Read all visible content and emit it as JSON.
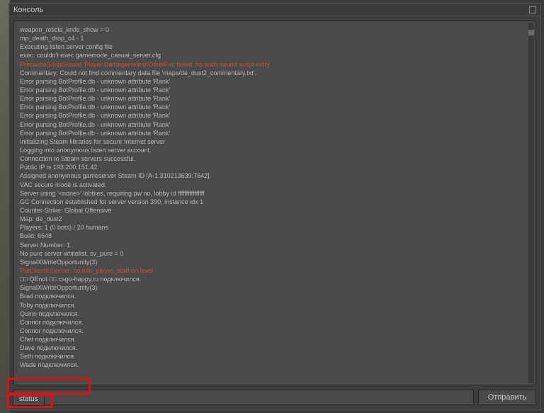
{
  "title": "Консоль",
  "send_label": "Отправить",
  "input_value": "status",
  "autocomplete_value": "status",
  "log_lines": [
    {
      "text": "weapon_reticle_knife_show = 0",
      "cls": ""
    },
    {
      "text": "mp_death_drop_c4 - 1",
      "cls": ""
    },
    {
      "text": "Executing listen server config file",
      "cls": ""
    },
    {
      "text": "exec: couldn't exec gamemode_casual_server.cfg",
      "cls": ""
    },
    {
      "text": "PrecacheScriptSound 'Player.DamageHelmetOtherFar' failed, no such sound script entry",
      "cls": "red"
    },
    {
      "text": "Commentary: Could not find commentary data file 'maps/de_dust2_commentary.txt'.",
      "cls": ""
    },
    {
      "text": "Error parsing BotProfile.db - unknown attribute 'Rank'",
      "cls": ""
    },
    {
      "text": "Error parsing BotProfile.db - unknown attribute 'Rank'",
      "cls": ""
    },
    {
      "text": "Error parsing BotProfile.db - unknown attribute 'Rank'",
      "cls": ""
    },
    {
      "text": "Error parsing BotProfile.db - unknown attribute 'Rank'",
      "cls": ""
    },
    {
      "text": "Error parsing BotProfile.db - unknown attribute 'Rank'",
      "cls": ""
    },
    {
      "text": "Error parsing BotProfile.db - unknown attribute 'Rank'",
      "cls": ""
    },
    {
      "text": "Error parsing BotProfile.db - unknown attribute 'Rank'",
      "cls": ""
    },
    {
      "text": "Initializing Steam libraries for secure Internet server",
      "cls": ""
    },
    {
      "text": "Logging into anonymous listen server account.",
      "cls": ""
    },
    {
      "text": "Connection to Steam servers successful.",
      "cls": ""
    },
    {
      "text": "   Public IP is 193.200.151.42.",
      "cls": ""
    },
    {
      "text": "Assigned anonymous gameserver Steam ID [A-1:310213639:7642].",
      "cls": ""
    },
    {
      "text": "VAC secure mode is activated.",
      "cls": ""
    },
    {
      "text": "Server using '<none>' lobbies, requiring pw no, lobby id ffffffffffffffff",
      "cls": ""
    },
    {
      "text": "GC Connection established for server version 390, instance idx 1",
      "cls": ""
    },
    {
      "text": " ",
      "cls": ""
    },
    {
      "text": "Counter-Strike: Global Offensive",
      "cls": ""
    },
    {
      "text": "Map: de_dust2",
      "cls": ""
    },
    {
      "text": "Players: 1 (0 bots) / 20 humans",
      "cls": ""
    },
    {
      "text": "Build: 6548",
      "cls": ""
    },
    {
      "text": "Server Number: 1",
      "cls": ""
    },
    {
      "text": " ",
      "cls": ""
    },
    {
      "text": "No pure server whitelist. sv_pure = 0",
      "cls": ""
    },
    {
      "text": "SignalXWriteOpportunity(3)",
      "cls": ""
    },
    {
      "text": "PutClientInServer: no info_player_start on level",
      "cls": "red"
    },
    {
      "text": "□□ QEnot □□ csgo-happy.ru подключился.",
      "cls": ""
    },
    {
      "text": "SignalXWriteOpportunity(3)",
      "cls": ""
    },
    {
      "text": "Brad подключился.",
      "cls": ""
    },
    {
      "text": "Toby подключился.",
      "cls": ""
    },
    {
      "text": "Quinn подключился.",
      "cls": ""
    },
    {
      "text": "Connor подключился.",
      "cls": ""
    },
    {
      "text": "Connor подключился.",
      "cls": ""
    },
    {
      "text": "Chet подключился.",
      "cls": ""
    },
    {
      "text": "Dave подключился.",
      "cls": ""
    },
    {
      "text": "Seth подключился.",
      "cls": ""
    },
    {
      "text": "Wade подключился.",
      "cls": ""
    }
  ]
}
